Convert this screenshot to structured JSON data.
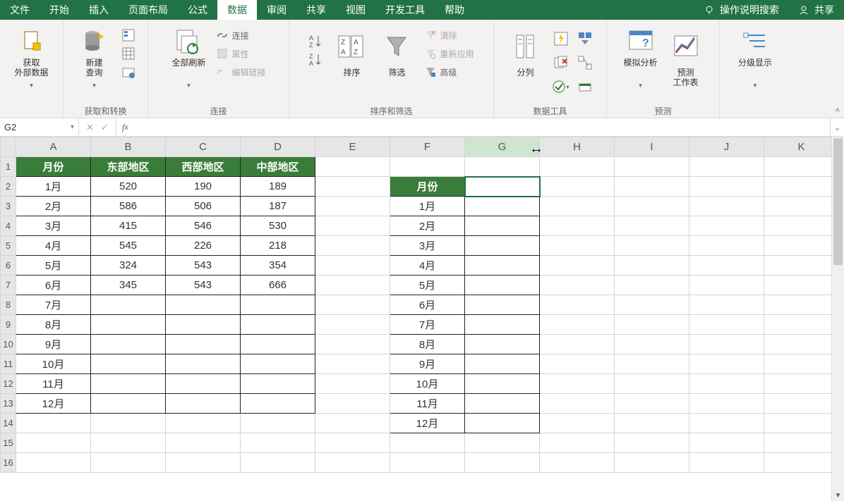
{
  "tabs": {
    "items": [
      "文件",
      "开始",
      "插入",
      "页面布局",
      "公式",
      "数据",
      "审阅",
      "共享",
      "视图",
      "开发工具",
      "帮助"
    ],
    "active_index": 5,
    "search": "操作说明搜索",
    "share": "共享"
  },
  "ribbon": {
    "group1": {
      "label": "获取和转换",
      "btn_external": "获取\n外部数据",
      "btn_newquery": "新建\n查询"
    },
    "group2": {
      "label": "连接",
      "btn_refresh": "全部刷新",
      "mini_conn": "连接",
      "mini_prop": "属性",
      "mini_edit": "编辑链接"
    },
    "group3": {
      "label": "排序和筛选",
      "btn_sort": "排序",
      "btn_filter": "筛选",
      "mini_clear": "清除",
      "mini_reapply": "重新应用",
      "mini_adv": "高级"
    },
    "group4": {
      "label": "数据工具",
      "btn_split": "分列"
    },
    "group5": {
      "label": "预测",
      "btn_whatif": "模拟分析",
      "btn_forecast": "预测\n工作表"
    },
    "group6": {
      "label": "",
      "btn_outline": "分级显示"
    }
  },
  "namebox": "G2",
  "formula": "",
  "columns": [
    "A",
    "B",
    "C",
    "D",
    "E",
    "F",
    "G",
    "H",
    "I",
    "J",
    "K"
  ],
  "selected_col_index": 6,
  "chart_data": {
    "type": "table",
    "headers": [
      "月份",
      "东部地区",
      "西部地区",
      "中部地区"
    ],
    "rows": [
      [
        "1月",
        520,
        190,
        189
      ],
      [
        "2月",
        586,
        506,
        187
      ],
      [
        "3月",
        415,
        546,
        530
      ],
      [
        "4月",
        545,
        226,
        218
      ],
      [
        "5月",
        324,
        543,
        354
      ],
      [
        "6月",
        345,
        543,
        666
      ],
      [
        "7月",
        "",
        "",
        ""
      ],
      [
        "8月",
        "",
        "",
        ""
      ],
      [
        "9月",
        "",
        "",
        ""
      ],
      [
        "10月",
        "",
        "",
        ""
      ],
      [
        "11月",
        "",
        "",
        ""
      ],
      [
        "12月",
        "",
        "",
        ""
      ]
    ]
  },
  "side_table": {
    "header": "月份",
    "rows": [
      "1月",
      "2月",
      "3月",
      "4月",
      "5月",
      "6月",
      "7月",
      "8月",
      "9月",
      "10月",
      "11月",
      "12月"
    ]
  },
  "row_count": 16
}
